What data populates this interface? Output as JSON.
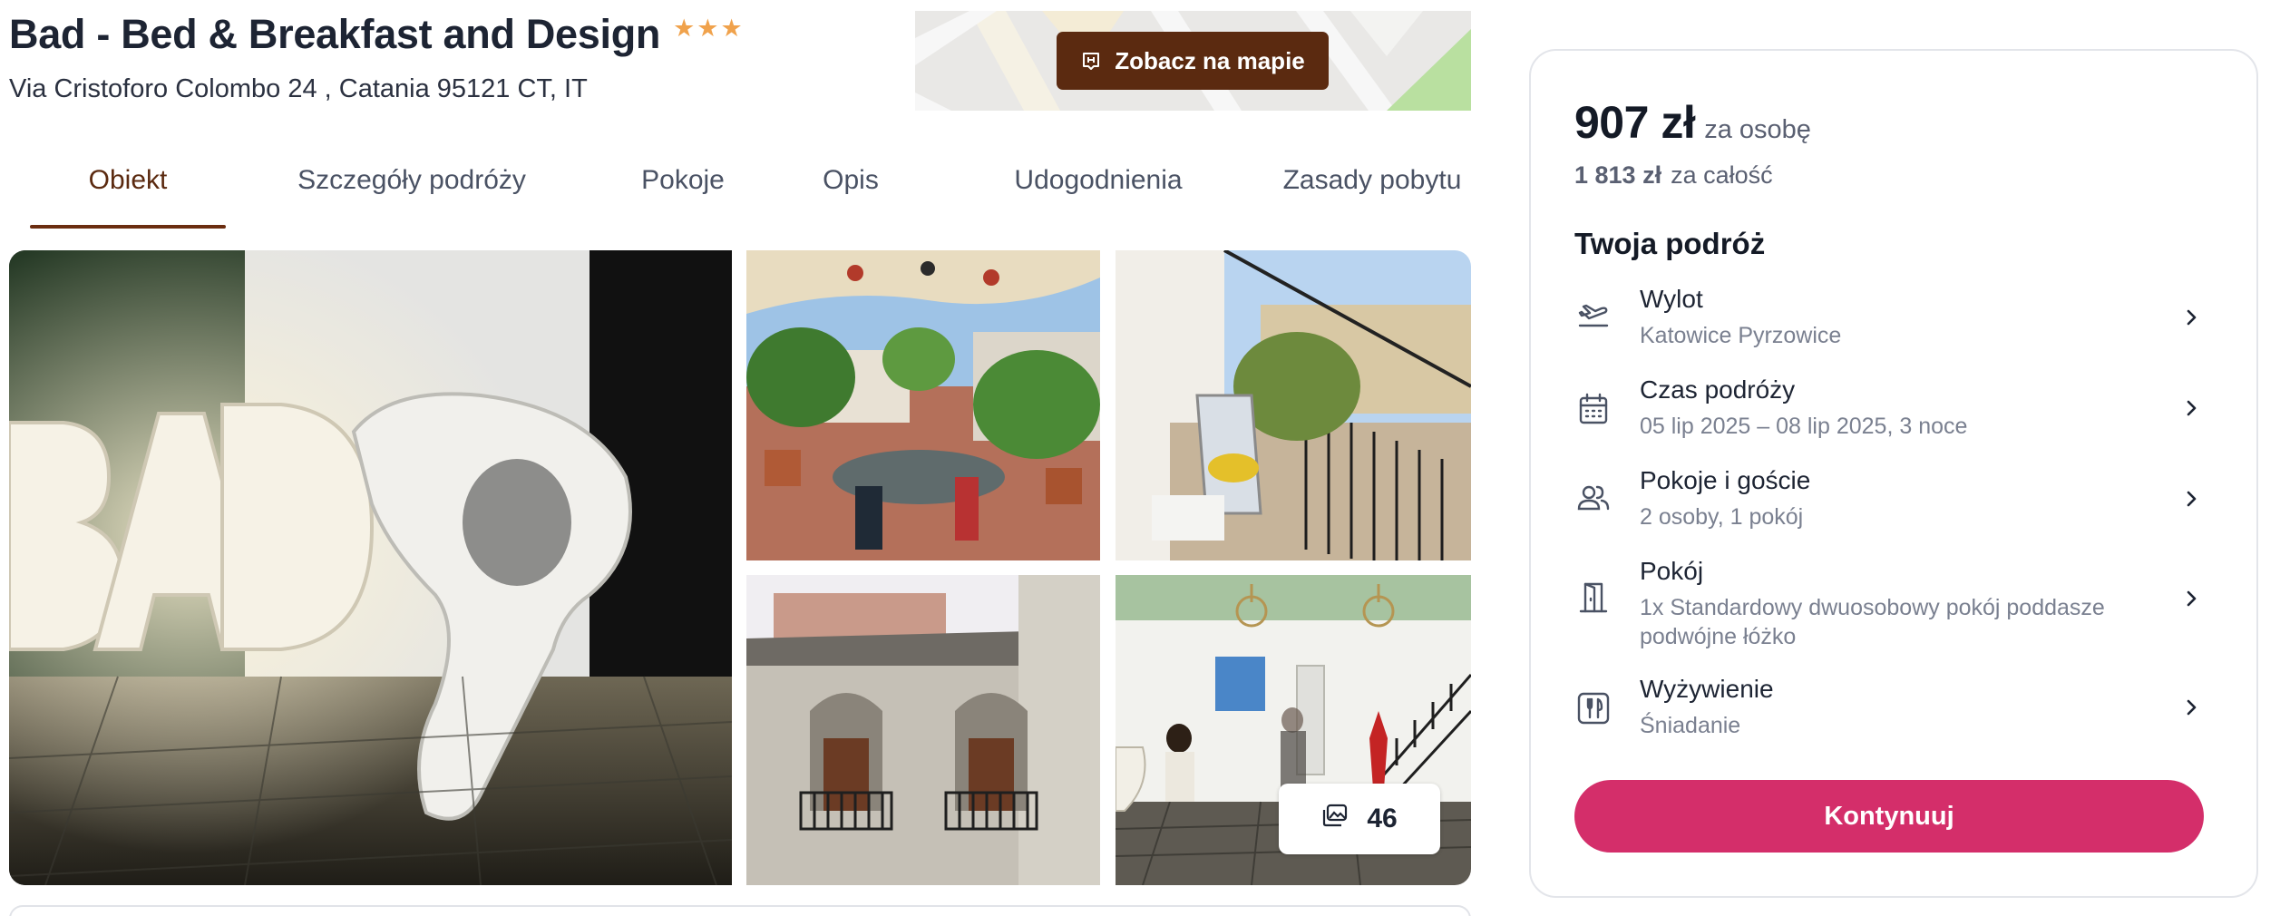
{
  "hotel": {
    "name": "Bad - Bed & Breakfast and Design",
    "stars": 3,
    "address": "Via Cristoforo Colombo 24 , Catania 95121 CT, IT"
  },
  "map": {
    "button_label": "Zobacz na mapie",
    "icon": "hotel-pin-icon"
  },
  "tabs": [
    {
      "label": "Obiekt",
      "active": true
    },
    {
      "label": "Szczegóły podróży",
      "active": false
    },
    {
      "label": "Pokoje",
      "active": false
    },
    {
      "label": "Opis",
      "active": false
    },
    {
      "label": "Udogodnienia",
      "active": false
    },
    {
      "label": "Zasady pobytu",
      "active": false
    }
  ],
  "gallery": {
    "photo_count": "46",
    "icon": "photos-icon"
  },
  "booking": {
    "price_per_person": "907 zł",
    "price_per_person_label": "za osobę",
    "price_total": "1 813 zł",
    "price_total_label": "za całość",
    "heading": "Twoja podróż",
    "items": [
      {
        "icon": "plane-departure-icon",
        "label": "Wylot",
        "value": "Katowice Pyrzowice"
      },
      {
        "icon": "calendar-icon",
        "label": "Czas podróży",
        "value": "05 lip 2025 – 08 lip 2025, 3 noce"
      },
      {
        "icon": "guests-icon",
        "label": "Pokoje i goście",
        "value": "2 osoby, 1 pokój"
      },
      {
        "icon": "door-icon",
        "label": "Pokój",
        "value": "1x Standardowy dwuosobowy pokój poddasze podwójne łóżko"
      },
      {
        "icon": "cutlery-icon",
        "label": "Wyżywienie",
        "value": "Śniadanie"
      }
    ],
    "continue_label": "Kontynuuj"
  },
  "colors": {
    "accent_brown": "#5b2a10",
    "star": "#f0a24c",
    "cta": "#d42e6a"
  }
}
